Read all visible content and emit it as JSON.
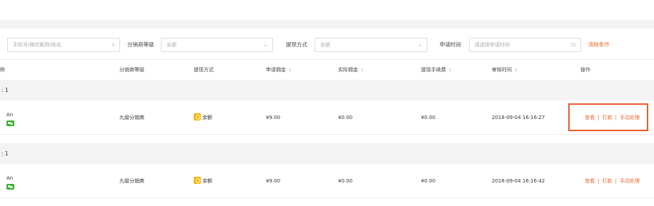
{
  "filters": {
    "search_placeholder": "手机号/微信昵称/姓名",
    "level_label": "分销商等级",
    "level_value": "全部",
    "method_label": "提现方式",
    "method_value": "全部",
    "time_label": "申请时间",
    "time_placeholder": "请选择申请时间",
    "clear_label": "清除条件"
  },
  "columns": {
    "name": "称",
    "level": "分销商等级",
    "method": "提现方式",
    "applied": "申请佣金",
    "actual": "实际佣金",
    "fee": "提现手续费",
    "review_time": "审核时间",
    "actions": "操作"
  },
  "sort_icon": "⇕",
  "groups": [
    {
      "header": ": 1",
      "row": {
        "name": "An",
        "level": "九级分销商",
        "method": "余额",
        "applied": "¥9.00",
        "actual": "¥0.00",
        "fee": "¥0.00",
        "review_time": "2018-09-04 16:16:27",
        "actions": {
          "view": "查看",
          "pay": "打款",
          "manual": "手动处理"
        }
      }
    },
    {
      "header": ": 1",
      "row": {
        "name": "An",
        "level": "九级分销商",
        "method": "余额",
        "applied": "¥9.00",
        "actual": "¥0.00",
        "fee": "¥0.00",
        "review_time": "2018-09-04 16:16:42",
        "actions": {
          "view": "查看",
          "pay": "打款",
          "manual": "手动处理"
        }
      }
    }
  ],
  "colors": {
    "accent": "#ef6a2e",
    "highlight_border": "#ec5a2a",
    "wechat_green": "#3cb034",
    "balance_yellow": "#f5b400"
  }
}
